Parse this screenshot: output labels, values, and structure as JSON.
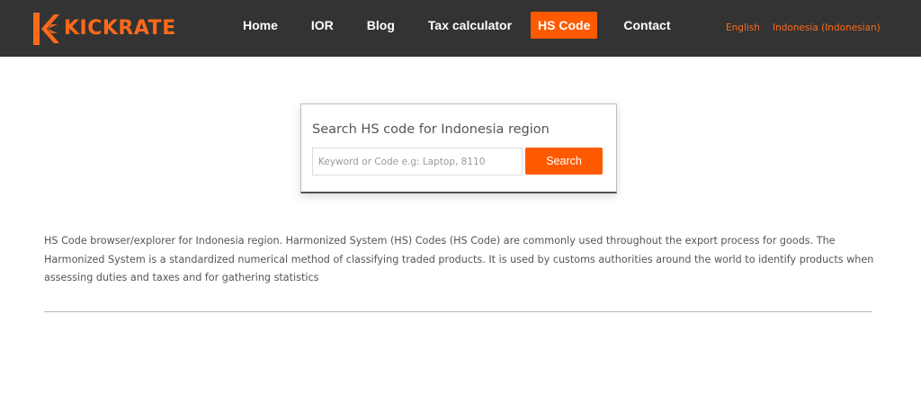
{
  "header": {
    "logo_text": "KICKRATE",
    "nav": [
      {
        "label": "Home",
        "active": false
      },
      {
        "label": "IOR",
        "active": false
      },
      {
        "label": "Blog",
        "active": false
      },
      {
        "label": "Tax calculator",
        "active": false
      },
      {
        "label": "HS Code",
        "active": true
      },
      {
        "label": "Contact",
        "active": false
      }
    ],
    "languages": [
      "English",
      "Indonesia (Indonesian)"
    ]
  },
  "search": {
    "title": "Search HS code for Indonesia region",
    "placeholder": "Keyword or Code e.g: Laptop, 8110",
    "value": "",
    "button_label": "Search"
  },
  "description": "HS Code browser/explorer for Indonesia region. Harmonized System (HS) Codes (HS Code) are commonly used throughout the export process for goods. The Harmonized System is a standardized numerical method of classifying traded products. It is used by customs authorities around the world to identify products when assessing duties and taxes and for gathering statistics",
  "colors": {
    "header_bg": "#333333",
    "accent": "#ff5a00",
    "logo": "#ff6a1a",
    "text": "#555555"
  }
}
